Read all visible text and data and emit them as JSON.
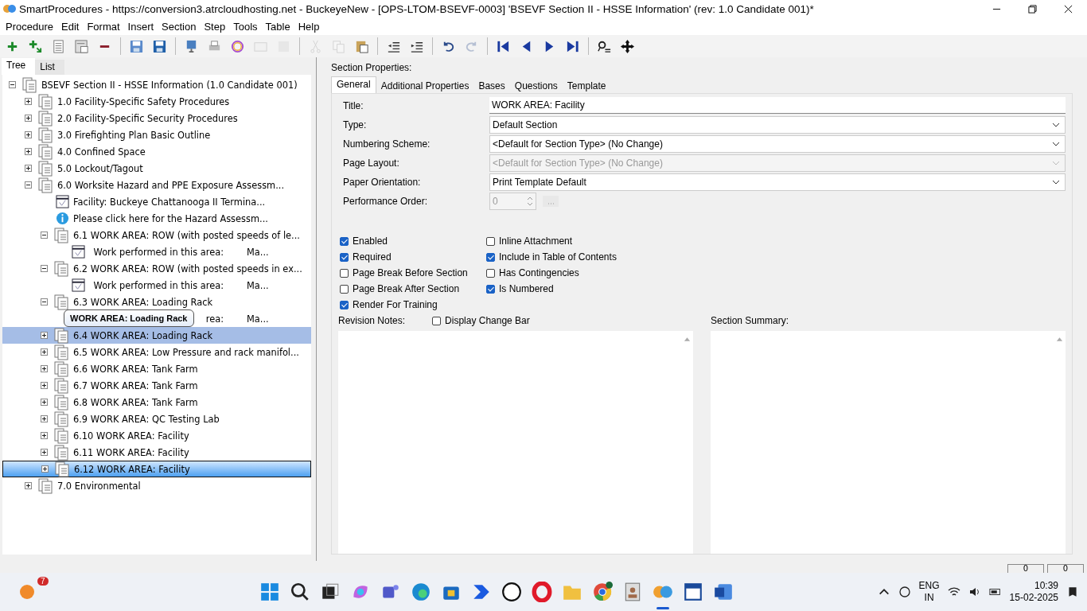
{
  "window": {
    "title": "SmartProcedures - https://conversion3.atrcloudhosting.net - BuckeyeNew - [OPS-LTOM-BSEVF-0003] 'BSEVF Section II - HSSE Information' (rev: 1.0 Candidate 001)*"
  },
  "menu": [
    "Procedure",
    "Edit",
    "Format",
    "Insert",
    "Section",
    "Step",
    "Tools",
    "Table",
    "Help"
  ],
  "toolbar": [
    {
      "kind": "add",
      "disabled": false
    },
    {
      "kind": "add-child",
      "disabled": false
    },
    {
      "kind": "list",
      "disabled": false
    },
    {
      "kind": "form",
      "disabled": false
    },
    {
      "kind": "remove",
      "disabled": false
    },
    {
      "kind": "sep"
    },
    {
      "kind": "save-all",
      "disabled": false
    },
    {
      "kind": "save",
      "disabled": false
    },
    {
      "kind": "sep"
    },
    {
      "kind": "monitor",
      "disabled": false
    },
    {
      "kind": "print",
      "disabled": false
    },
    {
      "kind": "ring",
      "disabled": false
    },
    {
      "kind": "envelope",
      "disabled": true
    },
    {
      "kind": "redo-doc",
      "disabled": true
    },
    {
      "kind": "sep"
    },
    {
      "kind": "cut",
      "disabled": true
    },
    {
      "kind": "copy",
      "disabled": true
    },
    {
      "kind": "paste",
      "disabled": false
    },
    {
      "kind": "sep"
    },
    {
      "kind": "outdent",
      "disabled": false
    },
    {
      "kind": "indent",
      "disabled": false
    },
    {
      "kind": "sep"
    },
    {
      "kind": "undo",
      "disabled": false
    },
    {
      "kind": "redo",
      "disabled": true
    },
    {
      "kind": "sep"
    },
    {
      "kind": "first",
      "disabled": false
    },
    {
      "kind": "prev",
      "disabled": false
    },
    {
      "kind": "next",
      "disabled": false
    },
    {
      "kind": "last",
      "disabled": false
    },
    {
      "kind": "sep"
    },
    {
      "kind": "find",
      "disabled": false
    },
    {
      "kind": "move",
      "disabled": false
    }
  ],
  "left_tabs": [
    {
      "label": "Tree",
      "selected": true
    },
    {
      "label": "List",
      "selected": false
    }
  ],
  "tree": [
    {
      "kind": "section",
      "label": "BSEVF Section II - HSSE Information (1.0 Candidate 001)",
      "expanded": true,
      "selected": false,
      "hovered": false,
      "children": [
        {
          "kind": "section",
          "label": "1.0 Facility-Specific Safety Procedures",
          "expanded": false,
          "selected": false,
          "hovered": false
        },
        {
          "kind": "section",
          "label": "2.0 Facility-Specific Security Procedures",
          "expanded": false,
          "selected": false,
          "hovered": false
        },
        {
          "kind": "section",
          "label": "3.0 Firefighting Plan Basic Outline",
          "expanded": false,
          "selected": false,
          "hovered": false
        },
        {
          "kind": "section",
          "label": "4.0 Confined Space",
          "expanded": false,
          "selected": false,
          "hovered": false
        },
        {
          "kind": "section",
          "label": "5.0 Lockout/Tagout",
          "expanded": false,
          "selected": false,
          "hovered": false
        },
        {
          "kind": "section",
          "label": "6.0 Worksite Hazard and PPE Exposure Assessm...",
          "expanded": true,
          "selected": false,
          "hovered": false,
          "children": [
            {
              "kind": "step",
              "label": "Facility: Buckeye Chattanooga II Termina...",
              "selected": false,
              "hovered": false
            },
            {
              "kind": "info",
              "label": "Please click here for the Hazard Assessm...",
              "selected": false,
              "hovered": false
            },
            {
              "kind": "section",
              "label": "6.1 WORK AREA: ROW (with posted speeds of le...",
              "expanded": true,
              "selected": false,
              "hovered": false,
              "children": [
                {
                  "kind": "step",
                  "label": "Work performed in this area:",
                  "value": "Ma...",
                  "selected": false,
                  "hovered": false
                }
              ]
            },
            {
              "kind": "section",
              "label": "6.2 WORK AREA: ROW (with posted speeds in ex...",
              "expanded": true,
              "selected": false,
              "hovered": false,
              "children": [
                {
                  "kind": "step",
                  "label": "Work performed in this area:",
                  "value": "Ma...",
                  "selected": false,
                  "hovered": false
                }
              ]
            },
            {
              "kind": "section",
              "label": "6.3 WORK AREA: Loading Rack",
              "expanded": true,
              "selected": false,
              "hovered": false,
              "children": [
                {
                  "kind": "step",
                  "label": "rea:",
                  "value": "Ma...",
                  "selected": false,
                  "hovered": false
                }
              ]
            },
            {
              "kind": "section",
              "label": "6.4 WORK AREA: Loading Rack",
              "expanded": false,
              "selected": false,
              "hovered": true
            },
            {
              "kind": "section",
              "label": "6.5 WORK AREA: Low Pressure and rack manifol...",
              "expanded": false,
              "selected": false,
              "hovered": false
            },
            {
              "kind": "section",
              "label": "6.6 WORK AREA: Tank Farm",
              "expanded": false,
              "selected": false,
              "hovered": false
            },
            {
              "kind": "section",
              "label": "6.7 WORK AREA: Tank Farm",
              "expanded": false,
              "selected": false,
              "hovered": false
            },
            {
              "kind": "section",
              "label": "6.8 WORK AREA: Tank Farm",
              "expanded": false,
              "selected": false,
              "hovered": false
            },
            {
              "kind": "section",
              "label": "6.9 WORK AREA: QC Testing Lab",
              "expanded": false,
              "selected": false,
              "hovered": false
            },
            {
              "kind": "section",
              "label": "6.10 WORK AREA: Facility",
              "expanded": false,
              "selected": false,
              "hovered": false
            },
            {
              "kind": "section",
              "label": "6.11 WORK AREA: Facility",
              "expanded": false,
              "selected": false,
              "hovered": false
            },
            {
              "kind": "section",
              "label": "6.12 WORK AREA: Facility",
              "expanded": false,
              "selected": true,
              "hovered": false
            }
          ]
        },
        {
          "kind": "section",
          "label": "7.0 Environmental",
          "expanded": false,
          "selected": false,
          "hovered": false
        }
      ]
    }
  ],
  "tooltip": {
    "text": "WORK AREA: Loading Rack"
  },
  "properties": {
    "heading": "Section Properties:",
    "tabs": [
      {
        "label": "General",
        "selected": true
      },
      {
        "label": "Additional Properties",
        "selected": false
      },
      {
        "label": "Bases",
        "selected": false
      },
      {
        "label": "Questions",
        "selected": false
      },
      {
        "label": "Template",
        "selected": false
      }
    ],
    "fields": [
      {
        "label": "Title:",
        "kind": "text",
        "value": "WORK AREA: Facility",
        "disabled": false
      },
      {
        "label": "Type:",
        "kind": "dropdown",
        "value": "Default Section",
        "disabled": false
      },
      {
        "label": "Numbering Scheme:",
        "kind": "dropdown",
        "value": "<Default for Section Type> (No Change)",
        "disabled": false
      },
      {
        "label": "Page Layout:",
        "kind": "dropdown",
        "value": "<Default for Section Type> (No Change)",
        "disabled": true
      },
      {
        "label": "Paper Orientation:",
        "kind": "dropdown",
        "value": "Print Template Default",
        "disabled": false
      },
      {
        "label": "Performance Order:",
        "kind": "spin",
        "value": "0",
        "disabled": true
      }
    ],
    "checkboxes": [
      {
        "label": "Enabled",
        "checked": true
      },
      {
        "label": "Inline Attachment",
        "checked": false
      },
      {
        "label": "Required",
        "checked": true
      },
      {
        "label": "Include in Table of Contents",
        "checked": true
      },
      {
        "label": "Page Break Before Section",
        "checked": false
      },
      {
        "label": "Has Contingencies",
        "checked": false
      },
      {
        "label": "Page Break After Section",
        "checked": false
      },
      {
        "label": "Is Numbered",
        "checked": true
      },
      {
        "label": "Render For Training",
        "checked": true
      }
    ],
    "revision_notes": {
      "label": "Revision Notes:",
      "change_bar": {
        "label": "Display Change Bar",
        "checked": false
      }
    },
    "section_summary": {
      "label": "Section Summary:"
    }
  },
  "status_bar": [
    "0",
    "0"
  ],
  "taskbar": {
    "notification_badge": "7",
    "apps": [
      {
        "kind": "windows"
      },
      {
        "kind": "search"
      },
      {
        "kind": "taskview"
      },
      {
        "kind": "copilot"
      },
      {
        "kind": "teams"
      },
      {
        "kind": "edge"
      },
      {
        "kind": "store"
      },
      {
        "kind": "automate"
      },
      {
        "kind": "dell"
      },
      {
        "kind": "opera"
      },
      {
        "kind": "folder"
      },
      {
        "kind": "chrome"
      },
      {
        "kind": "app"
      },
      {
        "kind": "smartproc",
        "selected": true
      },
      {
        "kind": "doc"
      },
      {
        "kind": "word"
      }
    ],
    "language": "ENG",
    "region": "IN",
    "time": "10:39",
    "date": "15-02-2025"
  }
}
